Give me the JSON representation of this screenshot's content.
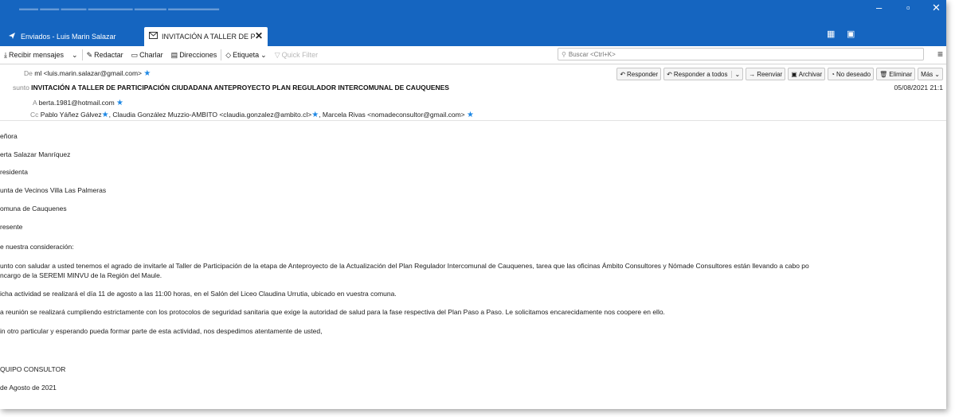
{
  "window": {
    "tab_sent": "Enviados - Luis Marin Salazar",
    "tab_message": "INVITACIÓN A TALLER DE P"
  },
  "toolbar": {
    "get_messages": "Recibir mensajes",
    "compose": "Redactar",
    "chat": "Charlar",
    "address_book": "Direcciones",
    "tag": "Etiqueta",
    "quick_filter": "Quick Filter",
    "search_placeholder": "Buscar <Ctrl+K>"
  },
  "header": {
    "from_label": "De",
    "from_value": "ml <luis.marin.salazar@gmail.com>",
    "subject_label": "sunto",
    "subject_value": "INVITACIÓN A TALLER DE PARTICIPACIÓN CIUDADANA ANTEPROYECTO PLAN REGULADOR INTERCOMUNAL DE CAUQUENES",
    "to_label": "A",
    "to_value": "berta.1981@hotmail.com",
    "cc_label": "Cc",
    "cc_1": "Pablo Yáñez Gálvez",
    "cc_2": ", Claudia González Muzzio-AMBITO <claudia.gonzalez@ambito.cl>",
    "cc_3": ", Marcela Rivas <nomadeconsultor@gmail.com>",
    "date": "05/08/2021 21:1"
  },
  "actions": {
    "reply": "Responder",
    "reply_all": "Responder a todos",
    "forward": "Reenviar",
    "archive": "Archivar",
    "junk": "No deseado",
    "delete": "Eliminar",
    "more": "Más"
  },
  "body": {
    "l1": "eñora",
    "l2": "erta Salazar Manríquez",
    "l3": "residenta",
    "l4": "unta de Vecinos Villa Las Palmeras",
    "l5": "omuna de Cauquenes",
    "l6": "resente",
    "l7": "e nuestra consideración:",
    "l8a": "unto con saludar a usted tenemos el agrado de invitarle al Taller de Participación de la etapa de Anteproyecto de la Actualización del Plan Regulador Intercomunal de Cauquenes, tarea que las oficinas Ámbito Consultores y Nómade Consultores están llevando a cabo po",
    "l8b": "ncargo de la SEREMI MINVU de la Región del Maule.",
    "l9": "icha actividad se realizará el día 11 de agosto a las 11:00 horas, en el Salón del Liceo Claudina Urrutia,  ubicado en vuestra comuna.",
    "l10": "a reunión se realizará cumpliendo estrictamente con los protocolos de seguridad sanitaria que exige la autoridad de salud para la fase respectiva del Plan Paso a Paso. Le solicitamos encarecidamente nos coopere en ello.",
    "l11": "in otro particular y esperando pueda formar parte de esta actividad, nos despedimos atentamente de usted,",
    "l12": "QUIPO CONSULTOR",
    "l13": " de Agosto de 2021"
  }
}
